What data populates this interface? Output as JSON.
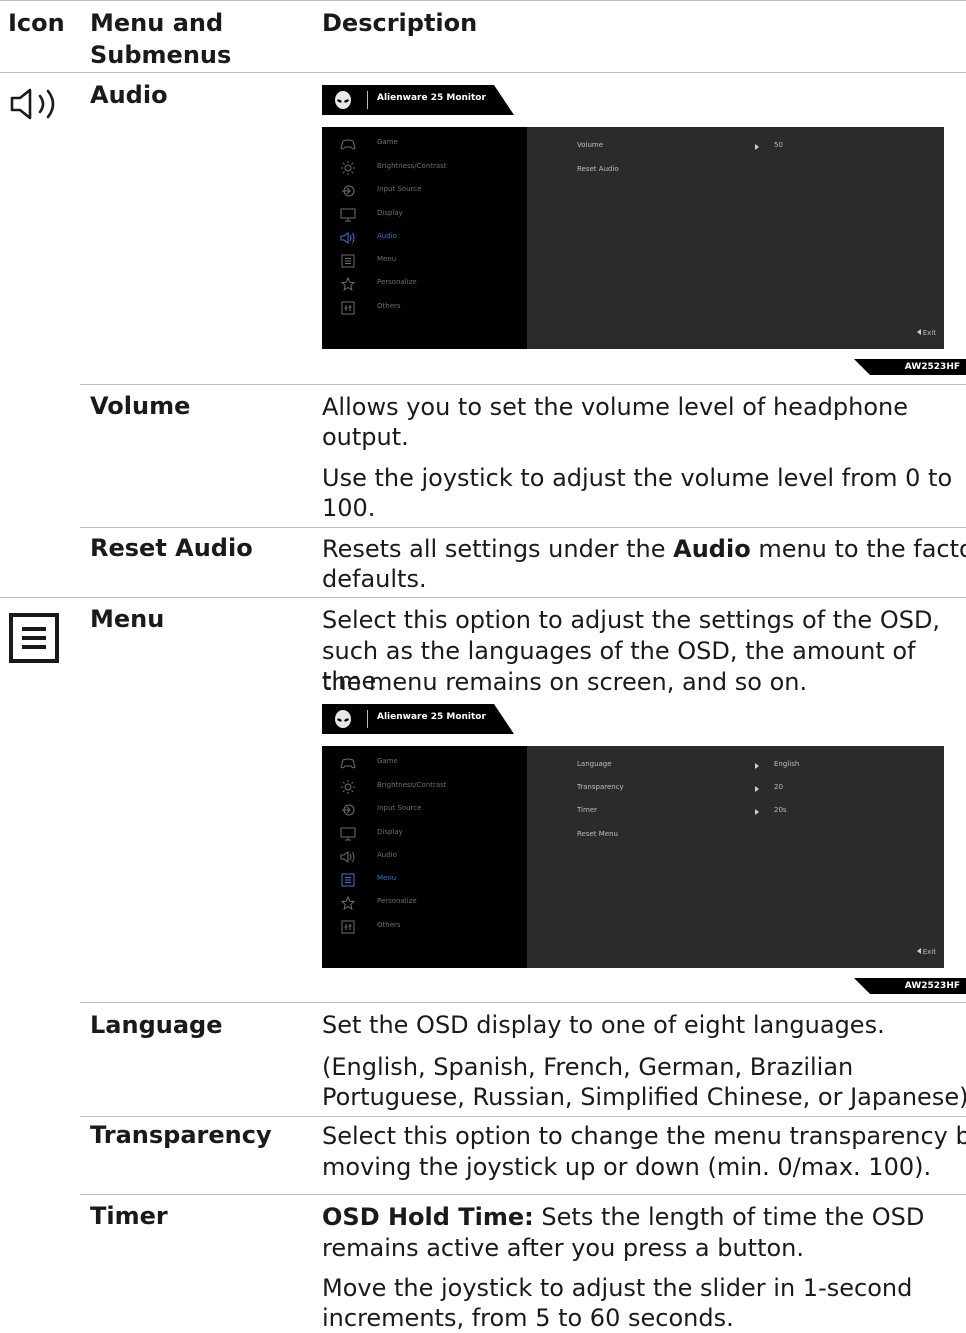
{
  "headers": {
    "icon": "Icon",
    "menu": "Menu and Submenus",
    "menu_line1": "Menu and",
    "menu_line2": "Submenus",
    "description": "Description"
  },
  "audio": {
    "title": "Audio",
    "icon": "speaker-icon",
    "osd": {
      "brand": "Alienware 25 Monitor",
      "model": "AW2523HF",
      "exit": "Exit",
      "menu_items": [
        "Game",
        "Brightness/Contrast",
        "Input Source",
        "Display",
        "Audio",
        "Menu",
        "Personalize",
        "Others"
      ],
      "active": "Audio",
      "settings": [
        {
          "label": "Volume",
          "value": "50"
        },
        {
          "label": "Reset Audio",
          "value": ""
        }
      ]
    },
    "volume": {
      "title": "Volume",
      "desc1_l1": "Allows you to set the volume level of headphone",
      "desc1_l2": "output.",
      "desc2_l1": "Use the joystick to adjust the volume level from 0 to",
      "desc2_l2": "100."
    },
    "reset": {
      "title": "Reset Audio",
      "desc_pre": "Resets all settings under the ",
      "desc_bold": "Audio",
      "desc_post": " menu to the factory",
      "desc_l2": "defaults."
    }
  },
  "menu": {
    "title": "Menu",
    "icon": "menu-list-icon",
    "desc_l1": "Select this option to adjust the settings of the OSD,",
    "desc_l2": "such as the languages of the OSD, the amount of time",
    "desc_l3": "the menu remains on screen, and so on.",
    "osd": {
      "brand": "Alienware 25 Monitor",
      "model": "AW2523HF",
      "exit": "Exit",
      "menu_items": [
        "Game",
        "Brightness/Contrast",
        "Input Source",
        "Display",
        "Audio",
        "Menu",
        "Personalize",
        "Others"
      ],
      "active": "Menu",
      "settings": [
        {
          "label": "Language",
          "value": "English"
        },
        {
          "label": "Transparency",
          "value": "20"
        },
        {
          "label": "Timer",
          "value": "20s"
        },
        {
          "label": "Reset Menu",
          "value": ""
        }
      ]
    },
    "language": {
      "title": "Language",
      "desc1": "Set the OSD display to one of eight languages.",
      "desc2_l1": "(English, Spanish, French, German, Brazilian",
      "desc2_l2": "Portuguese, Russian, Simplified Chinese, or Japanese)."
    },
    "transparency": {
      "title": "Transparency",
      "desc_l1": "Select this option to change the menu transparency by",
      "desc_l2": "moving the joystick up or down (min. 0/max. 100)."
    },
    "timer": {
      "title": "Timer",
      "desc1_bold": "OSD Hold Time:",
      "desc1_rest": " Sets the length of time the OSD",
      "desc1_l2": "remains active after you press a button.",
      "desc2_l1": "Move the joystick to adjust the slider in 1-second",
      "desc2_l2": "increments, from 5 to 60 seconds."
    }
  }
}
